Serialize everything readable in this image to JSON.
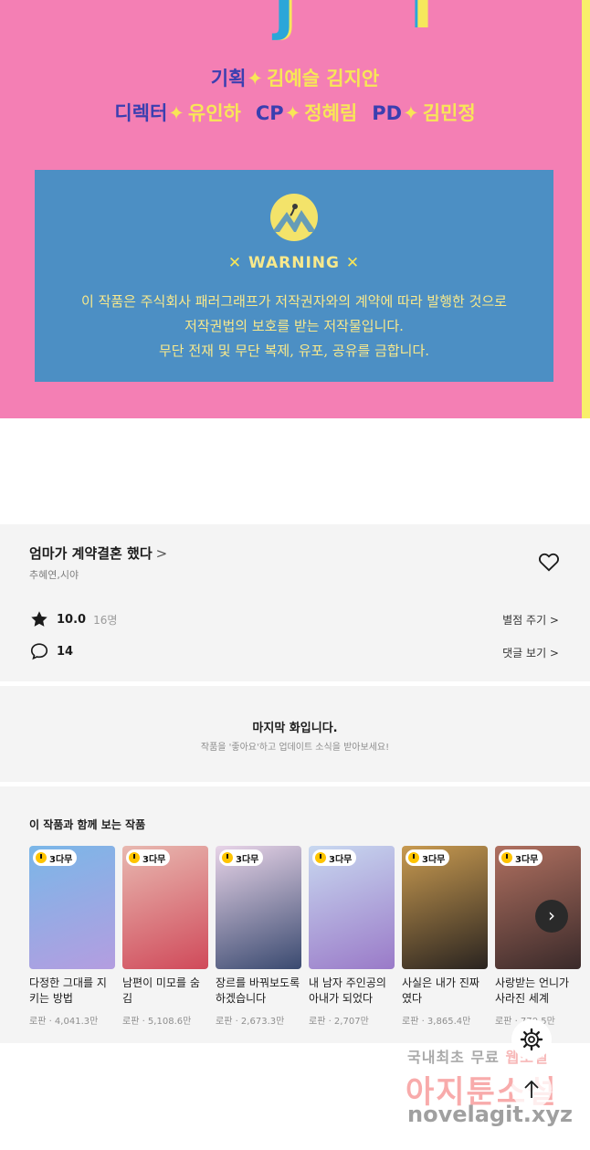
{
  "credits": {
    "line1": {
      "role": "기획",
      "names": "김예슬 김지안"
    },
    "line2": [
      {
        "role": "디렉터",
        "names": "유인하"
      },
      {
        "role": "CP",
        "names": "정혜림"
      },
      {
        "role": "PD",
        "names": "김민정"
      }
    ],
    "star": "✦",
    "warning": {
      "title": "WARNING",
      "x_mark": "✕",
      "line1": "이 작품은 주식회사 패러그래프가 저작권자와의 계약에 따라 발행한 것으로",
      "line2": "저작권법의 보호를 받는 저작물입니다.",
      "line3": "무단 전재 및 무단 복제, 유포, 공유를 금합니다."
    }
  },
  "series": {
    "title": "엄마가 계약결혼 했다",
    "chevron": ">",
    "authors": "추혜연,시야",
    "rating": "10.0",
    "rating_count": "16명",
    "comments": "14",
    "rate_link": "별점 주기 >",
    "comment_link": "댓글 보기 >"
  },
  "last_episode": {
    "title": "마지막 화입니다.",
    "subtitle": "작품을 '좋아요'하고 업데이트 소식을 받아보세요!"
  },
  "recommendations": {
    "title": "이 작품과 함께 보는 작품",
    "badge": "3다무",
    "items": [
      {
        "title": "다정한 그대를 지키는 방법",
        "meta": "로판 · 4,041.3만",
        "colors": [
          "#7ab7e8",
          "#b49de0"
        ]
      },
      {
        "title": "남편이 미모를 숨김",
        "meta": "로판 · 5,108.6만",
        "colors": [
          "#e8b8b0",
          "#d04a5a"
        ]
      },
      {
        "title": "장르를 바꿔보도록 하겠습니다",
        "meta": "로판 · 2,673.3만",
        "colors": [
          "#e8d4e8",
          "#3a4a70"
        ]
      },
      {
        "title": "내 남자 주인공의 아내가 되었다",
        "meta": "로판 · 2,707만",
        "colors": [
          "#c8d8f0",
          "#9a7ac8"
        ]
      },
      {
        "title": "사실은 내가 진짜였다",
        "meta": "로판 · 3,865.4만",
        "colors": [
          "#c89a50",
          "#2a2420"
        ]
      },
      {
        "title": "사랑받는 언니가 사라진 세계",
        "meta": "로판 · 770.5만",
        "colors": [
          "#b07060",
          "#3a2a2a"
        ]
      }
    ]
  },
  "watermark": {
    "line1a": "국내최초 무료",
    "line1b": "웹소설",
    "line2": "아지툰소설",
    "line3": "novelagit.xyz"
  },
  "colors": {
    "art_bg": "#f47fb4",
    "warning_bg": "#4c8fc4",
    "credit_role": "#3a3fb0",
    "credit_name": "#f8e657",
    "section_bg": "#f4f4f4"
  },
  "icons": [
    "star-icon",
    "comment-icon",
    "heart-icon",
    "settings-icon",
    "arrow-up-icon",
    "chevron-right-icon",
    "clock-icon"
  ]
}
